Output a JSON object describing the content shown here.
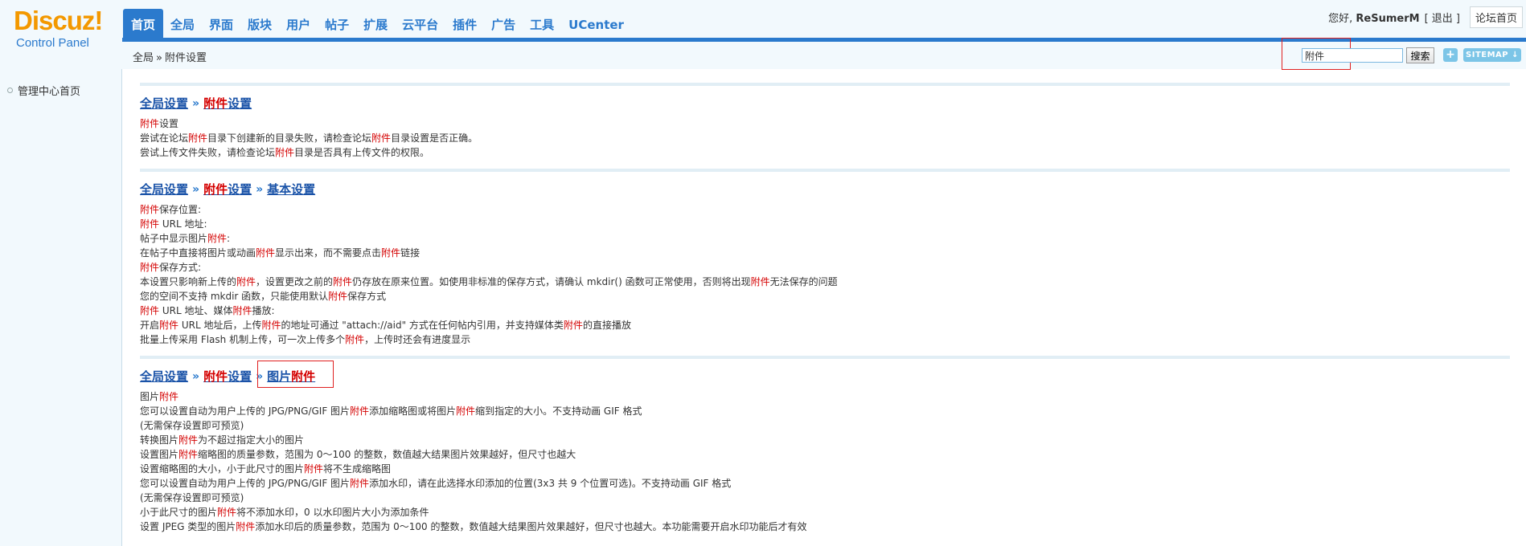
{
  "logo": {
    "word": "Discuz!",
    "subtitle": "Control Panel"
  },
  "nav": {
    "tabs": [
      "首页",
      "全局",
      "界面",
      "版块",
      "用户",
      "帖子",
      "扩展",
      "云平台",
      "插件",
      "广告",
      "工具",
      "UCenter"
    ],
    "active_index": 0
  },
  "header": {
    "greeting": "您好,",
    "username": "ReSumerM",
    "logout": "[ 退出 ]",
    "forum_home": "论坛首页"
  },
  "breadcrumb": {
    "part1": "全局",
    "sep": "»",
    "part2": "附件设置"
  },
  "search": {
    "value": "附件",
    "button": "搜索",
    "plus": "+",
    "sitemap": "SITEMAP ↓"
  },
  "sidebar": {
    "items": [
      {
        "label": "管理中心首页"
      }
    ]
  },
  "sections": [
    {
      "crumbs": [
        "全局设置",
        "附件设置"
      ],
      "lines": [
        "附件设置",
        "尝试在论坛附件目录下创建新的目录失败，请检查论坛附件目录设置是否正确。",
        "尝试上传文件失败，请检查论坛附件目录是否具有上传文件的权限。"
      ]
    },
    {
      "crumbs": [
        "全局设置",
        "附件设置",
        "基本设置"
      ],
      "lines": [
        "附件保存位置:",
        "附件 URL 地址:",
        "帖子中显示图片附件:",
        "在帖子中直接将图片或动画附件显示出来，而不需要点击附件链接",
        "附件保存方式:",
        "本设置只影响新上传的附件，设置更改之前的附件仍存放在原来位置。如使用非标准的保存方式，请确认 mkdir() 函数可正常使用，否则将出现附件无法保存的问题",
        "您的空间不支持 mkdir 函数，只能使用默认附件保存方式",
        "附件 URL 地址、媒体附件播放:",
        "开启附件 URL 地址后，上传附件的地址可通过 \"attach://aid\" 方式在任何帖内引用，并支持媒体类附件的直接播放",
        "批量上传采用 Flash 机制上传，可一次上传多个附件，上传时还会有进度显示"
      ]
    },
    {
      "crumbs": [
        "全局设置",
        "附件设置",
        "图片附件"
      ],
      "lines": [
        "图片附件",
        "您可以设置自动为用户上传的 JPG/PNG/GIF 图片附件添加缩略图或将图片附件缩到指定的大小。不支持动画 GIF 格式",
        "(无需保存设置即可预览)",
        "转换图片附件为不超过指定大小的图片",
        "设置图片附件缩略图的质量参数，范围为 0～100 的整数，数值越大结果图片效果越好，但尺寸也越大",
        "设置缩略图的大小，小于此尺寸的图片附件将不生成缩略图",
        "您可以设置自动为用户上传的 JPG/PNG/GIF 图片附件添加水印，请在此选择水印添加的位置(3x3 共 9 个位置可选)。不支持动画 GIF 格式",
        "(无需保存设置即可预览)",
        "小于此尺寸的图片附件将不添加水印，0 以水印图片大小为添加条件",
        "设置 JPEG 类型的图片附件添加水印后的质量参数，范围为 0～100 的整数，数值越大结果图片效果越好，但尺寸也越大。本功能需要开启水印功能后才有效"
      ]
    }
  ],
  "highlight_term": "附件",
  "colors": {
    "accent": "#2b7acd",
    "highlight": "#d40000",
    "logo_orange": "#f39800",
    "marker_red": "#e02020"
  }
}
